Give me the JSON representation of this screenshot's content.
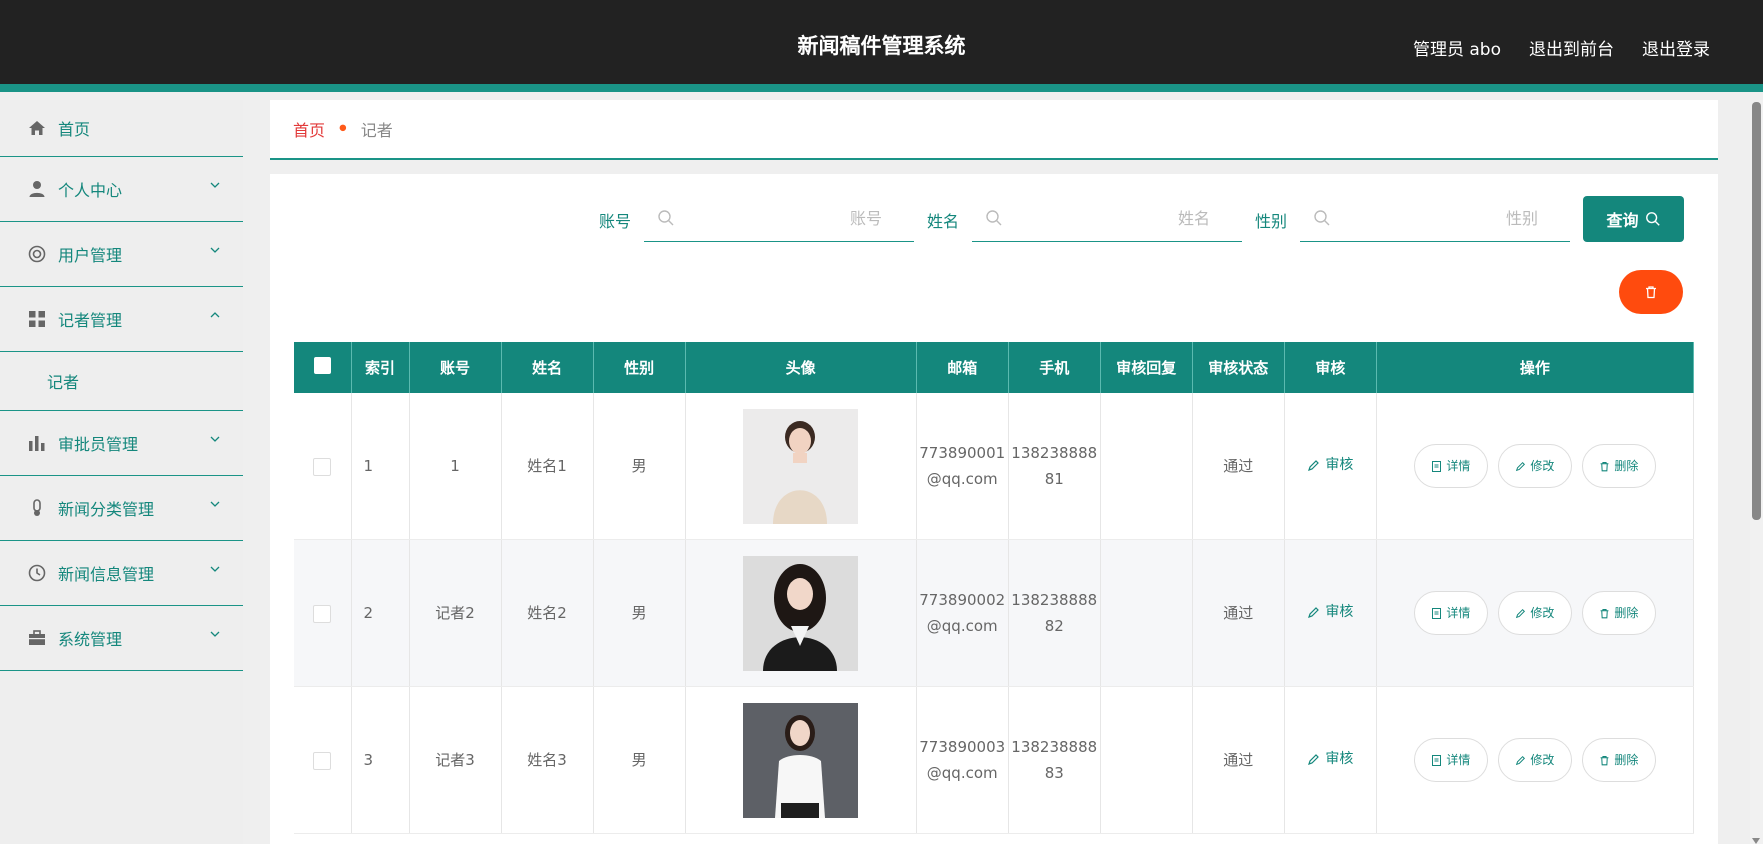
{
  "header": {
    "title": "新闻稿件管理系统",
    "admin_label": "管理员 abo",
    "exit_front": "退出到前台",
    "logout": "退出登录"
  },
  "sidebar": {
    "items": [
      {
        "label": "首页",
        "icon": "home-icon"
      },
      {
        "label": "个人中心",
        "icon": "user-icon"
      },
      {
        "label": "用户管理",
        "icon": "lifebuoy-icon"
      },
      {
        "label": "记者管理",
        "icon": "grid-icon"
      },
      {
        "label": "审批员管理",
        "icon": "bar-chart-icon"
      },
      {
        "label": "新闻分类管理",
        "icon": "thermometer-icon"
      },
      {
        "label": "新闻信息管理",
        "icon": "clock-icon"
      },
      {
        "label": "系统管理",
        "icon": "briefcase-icon"
      }
    ],
    "submenu_label": "记者"
  },
  "breadcrumb": {
    "home": "首页",
    "current": "记者"
  },
  "search": {
    "account_label": "账号",
    "account_placeholder": "账号",
    "name_label": "姓名",
    "name_placeholder": "姓名",
    "gender_label": "性别",
    "gender_placeholder": "性别",
    "query_label": "查询"
  },
  "table": {
    "headers": [
      "索引",
      "账号",
      "姓名",
      "性别",
      "头像",
      "邮箱",
      "手机",
      "审核回复",
      "审核状态",
      "审核",
      "操作"
    ],
    "audit_label": "审核",
    "ops": {
      "detail": "详情",
      "edit": "修改",
      "delete": "删除"
    },
    "rows": [
      {
        "index": "1",
        "account": "1",
        "name": "姓名1",
        "gender": "男",
        "email": "773890001@qq.com",
        "phone": "13823888881",
        "reply": "",
        "status": "通过"
      },
      {
        "index": "2",
        "account": "记者2",
        "name": "姓名2",
        "gender": "男",
        "email": "773890002@qq.com",
        "phone": "13823888882",
        "reply": "",
        "status": "通过"
      },
      {
        "index": "3",
        "account": "记者3",
        "name": "姓名3",
        "gender": "男",
        "email": "773890003@qq.com",
        "phone": "13823888883",
        "reply": "",
        "status": "通过"
      }
    ]
  },
  "colors": {
    "accent": "#14877c",
    "topbar": "#222222",
    "danger": "#ff4b0e",
    "breadcrumb_home": "#e23a3a"
  }
}
